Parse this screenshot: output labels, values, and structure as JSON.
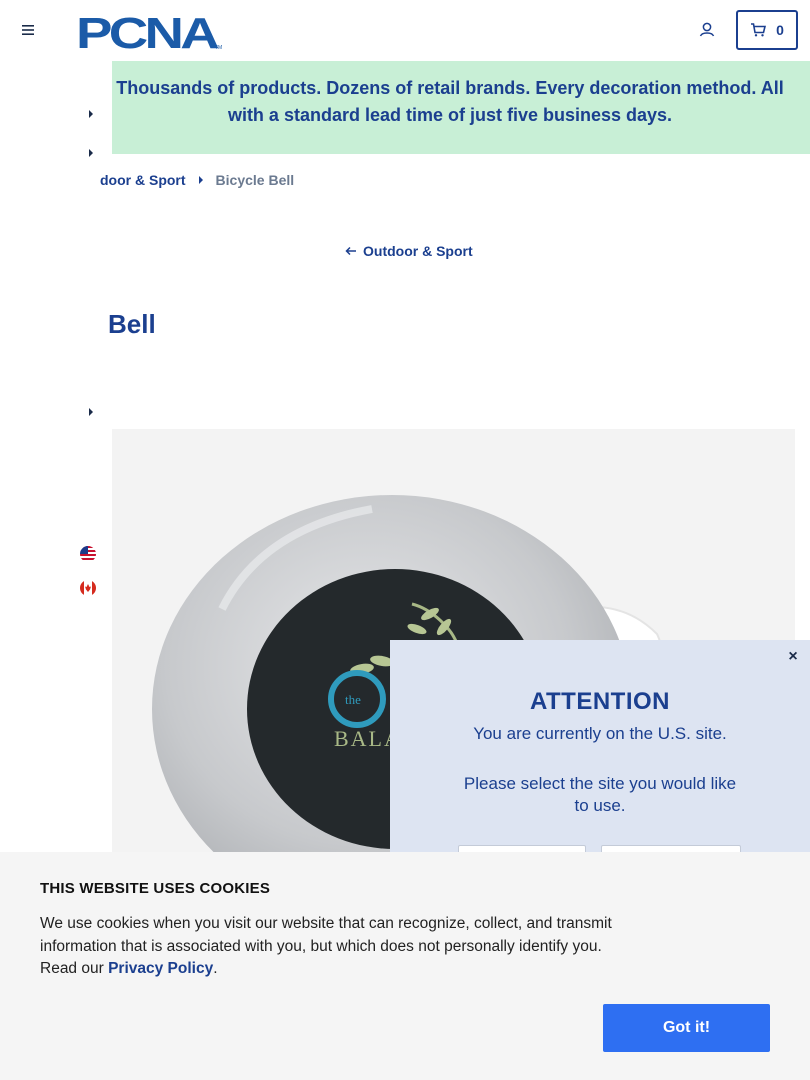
{
  "header": {
    "logo_text": "PCNA",
    "logo_tm": "TM",
    "cart_count": "0"
  },
  "banner": {
    "text": "Thousands of products. Dozens of retail brands. Every decoration method. All with a standard lead time of just five business days."
  },
  "breadcrumb": {
    "parent": "door & Sport",
    "current": "Bicycle Bell"
  },
  "back_link": "Outdoor & Sport",
  "product": {
    "title_fragment": "Bell",
    "image_text_small": "the",
    "image_text": "BALA"
  },
  "attention": {
    "title": "ATTENTION",
    "line1": "You are currently on the U.S. site.",
    "line2": "Please select the site you would like to use."
  },
  "cookie": {
    "title": "THIS WEBSITE USES COOKIES",
    "body_before": "We use cookies when you visit our website that can recognize, collect, and transmit information that is associated with you, but which does not personally identify you. Read our ",
    "privacy_link": "Privacy Policy",
    "body_after": ".",
    "button": "Got it!"
  },
  "colors": {
    "brand_blue": "#1b3f8f",
    "banner_green": "#c8efd6",
    "cookie_button": "#2e6ff2",
    "modal_bg": "#dde4f2"
  },
  "icons": [
    "hamburger-menu-icon",
    "account-icon",
    "cart-icon",
    "chevron-right-icon",
    "arrow-left-icon",
    "close-icon",
    "us-flag-icon",
    "canada-flag-icon"
  ]
}
